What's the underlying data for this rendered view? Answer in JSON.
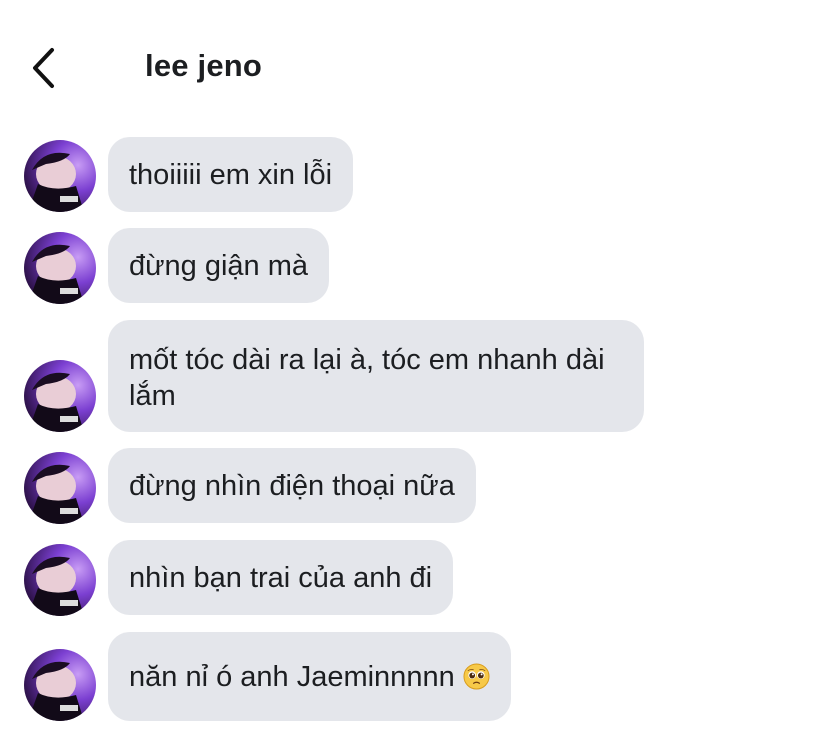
{
  "header": {
    "back_icon": "chevron-left-icon",
    "contact_name": "lee jeno"
  },
  "messages": [
    {
      "text": "thoiiiii em xin lỗi"
    },
    {
      "text": "đừng giận mà"
    },
    {
      "text": "mốt tóc dài ra lại à, tóc em nhanh dài lắm"
    },
    {
      "text": "đừng nhìn điện thoại nữa"
    },
    {
      "text": "nhìn bạn trai của anh đi"
    },
    {
      "text": "năn nỉ ó anh Jaeminnnnn",
      "emoji": "pleading-face-emoji"
    }
  ],
  "colors": {
    "bubble_bg": "#e4e6eb",
    "text": "#1c1e21",
    "avatar_purple": "#7b3fd1"
  }
}
